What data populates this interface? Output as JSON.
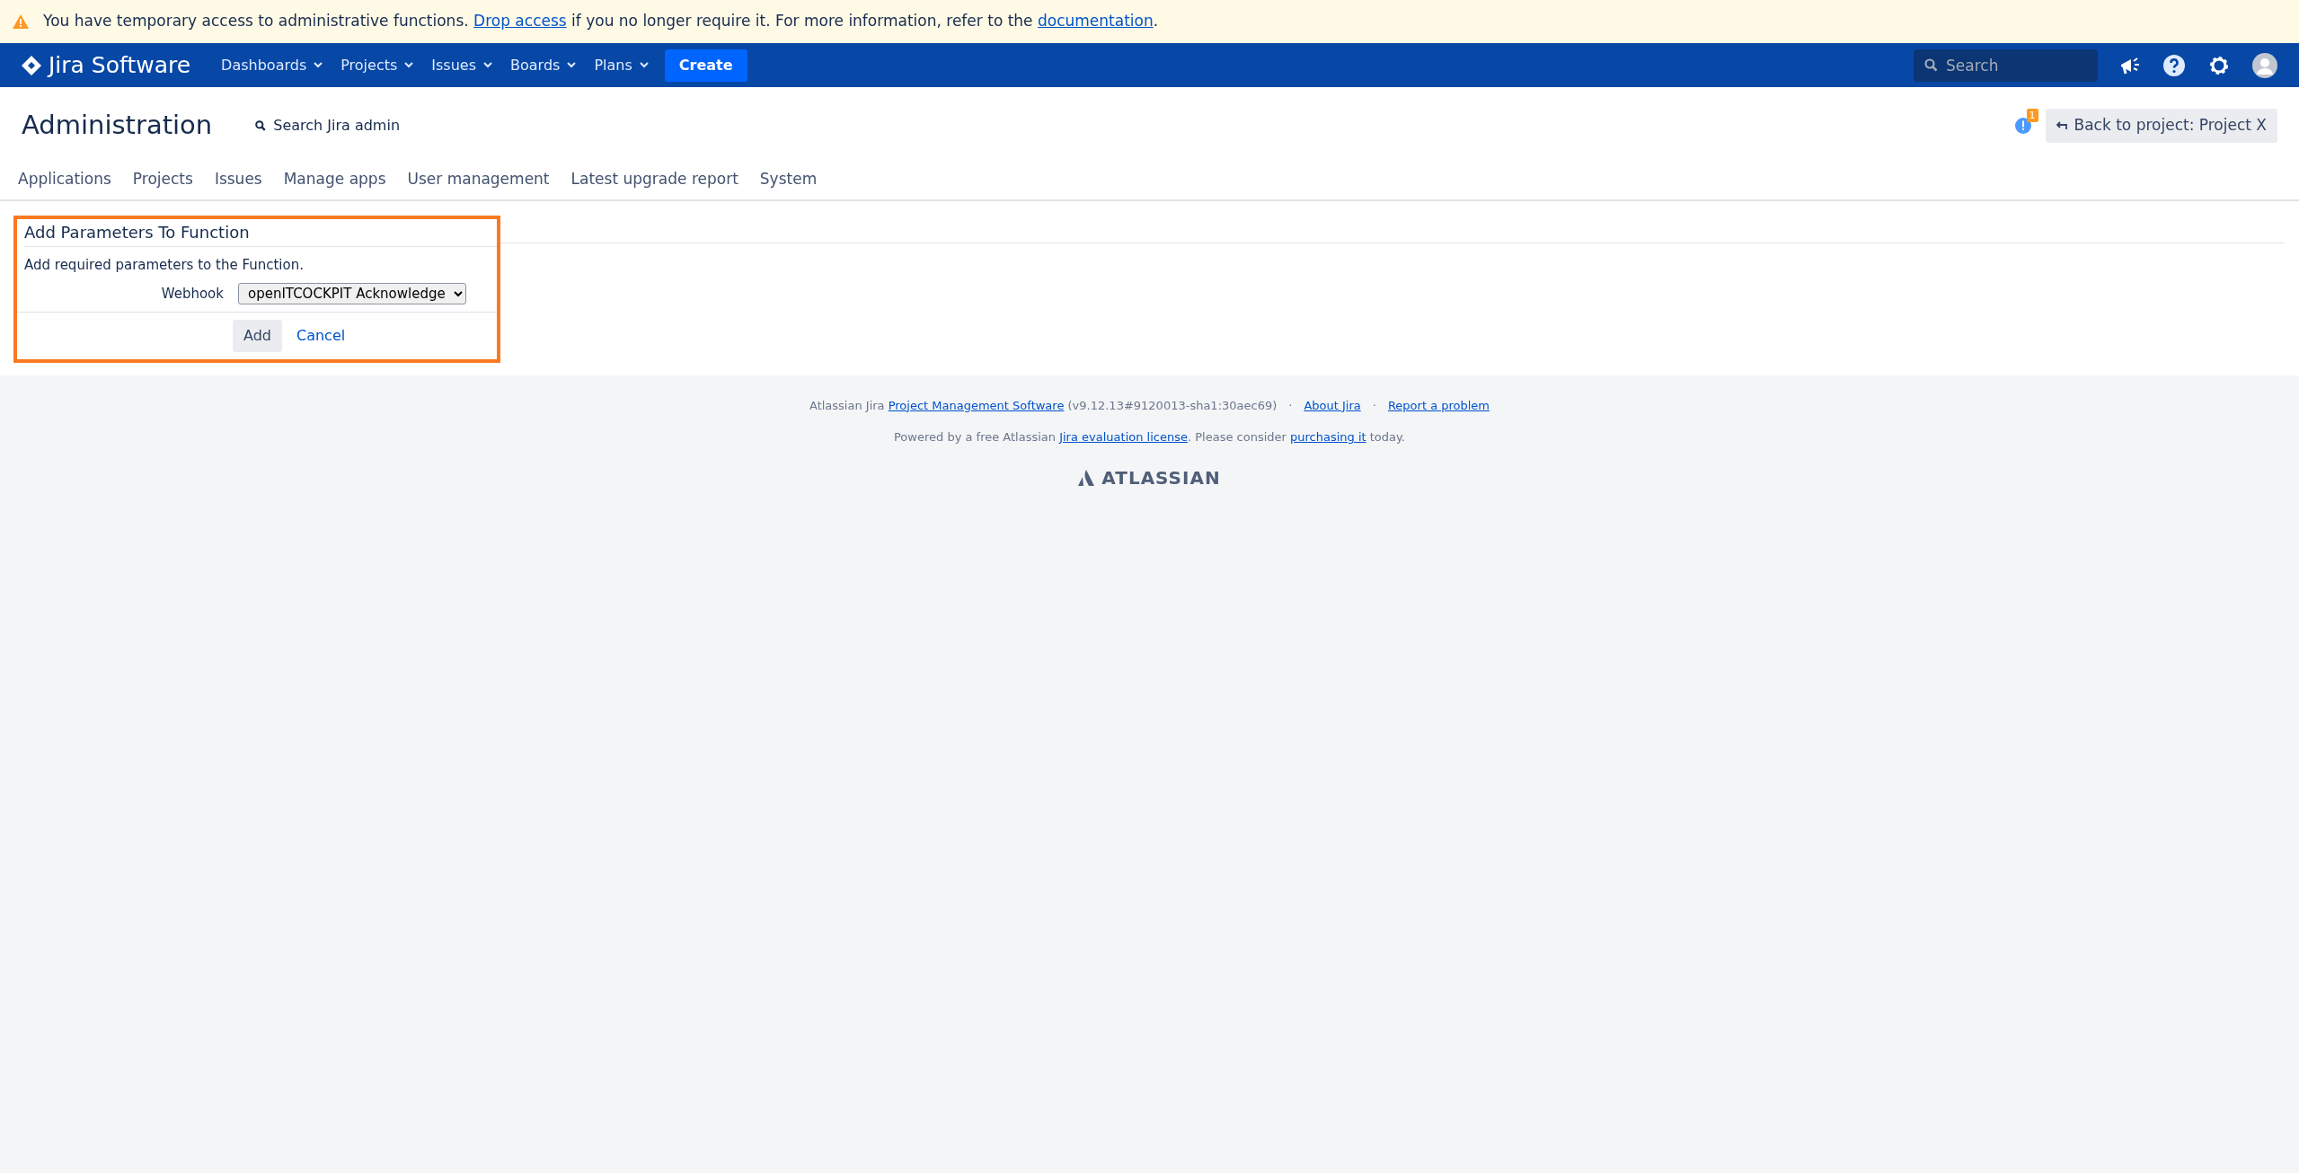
{
  "banner": {
    "segments": [
      {
        "kind": "text",
        "text": "You have temporary access to administrative functions. "
      },
      {
        "kind": "link",
        "text": "Drop access"
      },
      {
        "kind": "text",
        "text": " if you no longer require it. For more information, refer to the "
      },
      {
        "kind": "link",
        "text": "documentation"
      },
      {
        "kind": "text",
        "text": "."
      }
    ]
  },
  "navbar": {
    "logo": "Jira Software",
    "menus": [
      {
        "label": "Dashboards"
      },
      {
        "label": "Projects"
      },
      {
        "label": "Issues"
      },
      {
        "label": "Boards"
      },
      {
        "label": "Plans"
      }
    ],
    "create": "Create",
    "search": {
      "placeholder": "Search"
    }
  },
  "admin": {
    "title": "Administration",
    "search": "Search Jira admin",
    "notification_count": "1",
    "back_button": "Back to project: Project X"
  },
  "tabs": [
    {
      "label": "Applications",
      "selected": false
    },
    {
      "label": "Projects",
      "selected": false
    },
    {
      "label": "Issues",
      "selected": false
    },
    {
      "label": "Manage apps",
      "selected": false
    },
    {
      "label": "User management",
      "selected": false
    },
    {
      "label": "Latest upgrade report",
      "selected": false
    },
    {
      "label": "System",
      "selected": false
    }
  ],
  "form": {
    "title": "Add Parameters To Function",
    "description": "Add required parameters to the Function.",
    "field_label": "Webhook",
    "field_value": "openITCOCKPIT Acknowledge",
    "submit": "Add",
    "cancel": "Cancel"
  },
  "footer": {
    "lines": [
      {
        "segments": [
          {
            "kind": "text",
            "text": "Atlassian Jira "
          },
          {
            "kind": "link",
            "text": "Project Management Software"
          },
          {
            "kind": "text",
            "text": " (v9.12.13#9120013-sha1:30aec69)"
          },
          {
            "kind": "sep",
            "text": "·"
          },
          {
            "kind": "link",
            "text": "About Jira"
          },
          {
            "kind": "sep",
            "text": "·"
          },
          {
            "kind": "link",
            "text": "Report a problem"
          }
        ]
      },
      {
        "segments": [
          {
            "kind": "text",
            "text": "Powered by a free Atlassian "
          },
          {
            "kind": "link",
            "text": "Jira evaluation license"
          },
          {
            "kind": "text",
            "text": ". Please consider "
          },
          {
            "kind": "link",
            "text": "purchasing it"
          },
          {
            "kind": "text",
            "text": " today."
          }
        ]
      }
    ],
    "brand": "ATLASSIAN"
  }
}
